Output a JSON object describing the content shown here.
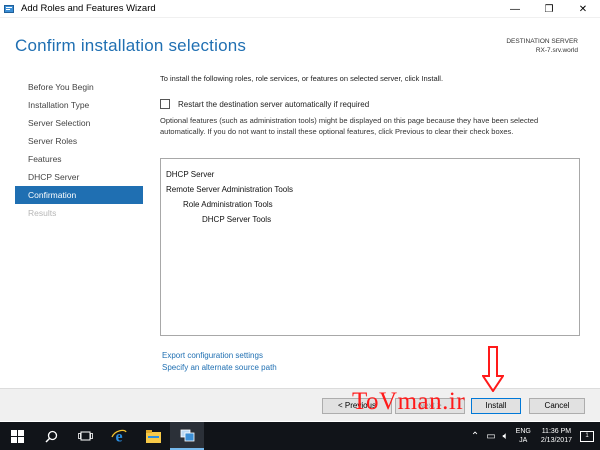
{
  "window": {
    "title": "Add Roles and Features Wizard",
    "minimize_glyph": "—",
    "restore_glyph": "❐",
    "close_glyph": "✕"
  },
  "header": {
    "title": "Confirm installation selections",
    "dest_label": "DESTINATION SERVER",
    "dest_value": "RX-7.srv.world"
  },
  "nav": {
    "items": [
      {
        "label": "Before You Begin",
        "state": "normal"
      },
      {
        "label": "Installation Type",
        "state": "normal"
      },
      {
        "label": "Server Selection",
        "state": "normal"
      },
      {
        "label": "Server Roles",
        "state": "normal"
      },
      {
        "label": "Features",
        "state": "normal"
      },
      {
        "label": "DHCP Server",
        "state": "normal"
      },
      {
        "label": "Confirmation",
        "state": "active"
      },
      {
        "label": "Results",
        "state": "disabled"
      }
    ]
  },
  "content": {
    "intro": "To install the following roles, role services, or features on selected server, click Install.",
    "restart_checkbox_label": "Restart the destination server automatically if required",
    "restart_checked": false,
    "optional_text": "Optional features (such as administration tools) might be displayed on this page because they have been selected automatically. If you do not want to install these optional features, click Previous to clear their check boxes.",
    "selections": [
      {
        "label": "DHCP Server",
        "level": 0
      },
      {
        "label": "Remote Server Administration Tools",
        "level": 0
      },
      {
        "label": "Role Administration Tools",
        "level": 1
      },
      {
        "label": "DHCP Server Tools",
        "level": 2
      }
    ],
    "export_link": "Export configuration settings",
    "alt_source_link": "Specify an alternate source path"
  },
  "buttons": {
    "previous": "< Previous",
    "next": "Next >",
    "install": "Install",
    "cancel": "Cancel"
  },
  "overlay": {
    "watermark": "ToVman.ir",
    "arrow_color": "#ff1a1a"
  },
  "taskbar": {
    "icons": [
      "windows-start-icon",
      "search-icon",
      "task-view-icon",
      "internet-explorer-icon",
      "file-explorer-icon",
      "server-manager-icon"
    ],
    "lang_top": "ENG",
    "lang_bottom": "JA",
    "time": "11:36 PM",
    "date": "2/13/2017",
    "notification_count": "1"
  },
  "colors": {
    "accent": "#1f6fb2",
    "taskbar": "#111419"
  }
}
